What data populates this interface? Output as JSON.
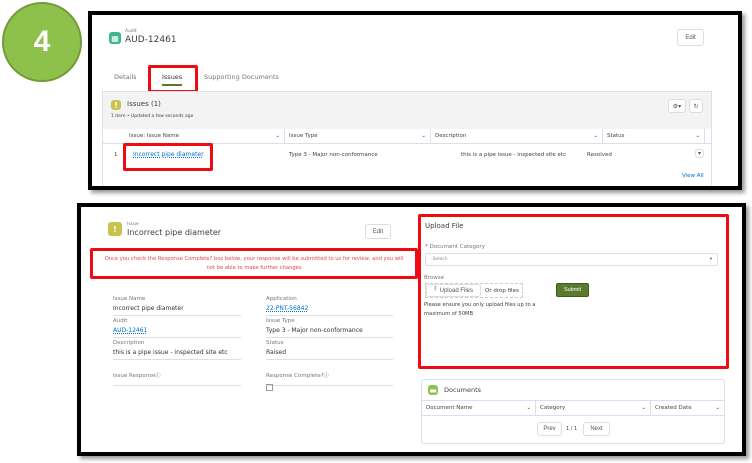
{
  "step": "4",
  "audit": {
    "object_label": "Audit",
    "record": "AUD-12461",
    "edit": "Edit",
    "tabs": [
      "Details",
      "Issues",
      "Supporting Documents"
    ],
    "issues": {
      "title": "Issues (1)",
      "subtitle": "1 item • Updated a few seconds ago",
      "columns": [
        "Issue: Issue Name",
        "Issue Type",
        "Description",
        "Status"
      ],
      "rows": [
        {
          "num": "1",
          "name": "Incorrect pipe diameter",
          "type": "Type 3 - Major non-conformance",
          "description": "this is a pipe issue - inspected site etc",
          "status": "Resolved"
        }
      ],
      "view_all": "View All"
    }
  },
  "issue": {
    "object_label": "Issue",
    "title": "Incorrect pipe diameter",
    "edit": "Edit",
    "warning": "Once you check the Response Complete? box below, your response will be submitted to us for review, and you will not be able to make further changes",
    "fields": {
      "issue_name_label": "Issue Name",
      "issue_name": "Incorrect pipe diameter",
      "application_label": "Application",
      "application": "22-PNT-56842",
      "audit_label": "Audit",
      "audit": "AUD-12461",
      "issue_type_label": "Issue Type",
      "issue_type": "Type 3 - Major non-conformance",
      "description_label": "Description",
      "description": "this is a pipe issue - inspected site etc",
      "status_label": "Status",
      "status": "Raised",
      "response_label": "Issue Response",
      "complete_label": "Response Complete?"
    }
  },
  "upload": {
    "title": "Upload File",
    "category_label": "Document Category",
    "category_placeholder": "-Select-",
    "browse": "Browse",
    "upload_btn": "Upload Files",
    "drop": "Or drop files",
    "submit": "Submit",
    "note": "Please ensure you only upload files up to a maximum of 50MB"
  },
  "documents": {
    "title": "Documents",
    "columns": [
      "Document Name",
      "Category",
      "Created Date"
    ],
    "prev": "Prev",
    "page": "1 / 1",
    "next": "Next"
  },
  "colors": {
    "accent": "#5a7a30",
    "highlight": "#f00a12",
    "step": "#8dc14b"
  }
}
